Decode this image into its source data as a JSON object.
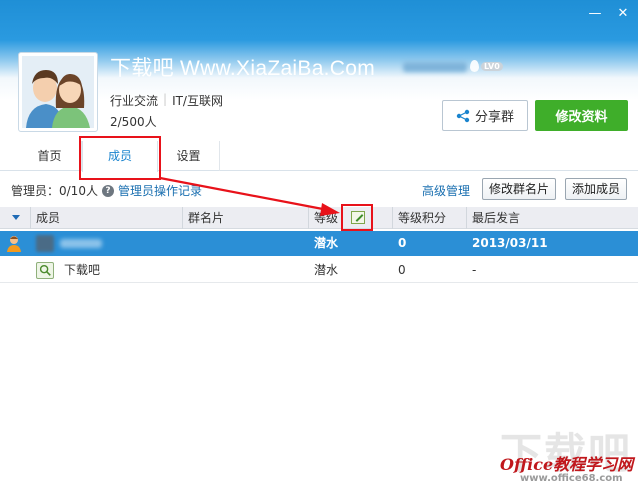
{
  "window": {
    "minimize_glyph": "—",
    "close_glyph": "✕"
  },
  "group": {
    "name": "下载吧 Www.XiaZaiBa.Com",
    "level_badge": "LV0",
    "category_1": "行业交流",
    "category_2": "IT/互联网",
    "members": "2/500人"
  },
  "buttons": {
    "share": "分享群",
    "edit_profile": "修改资料"
  },
  "tabs": [
    {
      "label": "首页"
    },
    {
      "label": "成员",
      "active": true
    },
    {
      "label": "设置"
    }
  ],
  "toolbar": {
    "admin_count": "管理员：0/10人",
    "admin_log": "管理员操作记录",
    "advanced": "高级管理",
    "edit_card": "修改群名片",
    "add_member": "添加成员"
  },
  "table": {
    "headers": [
      "成员",
      "群名片",
      "等级",
      "等级积分",
      "最后发言"
    ],
    "rows": [
      {
        "member": "",
        "card": "",
        "level": "潜水",
        "points": "0",
        "last_post": "2013/03/11",
        "selected": true
      },
      {
        "member": "下载吧",
        "card": "",
        "level": "潜水",
        "points": "0",
        "last_post": "-",
        "selected": false
      }
    ]
  },
  "watermark": {
    "big": "下载吧",
    "line1": "Office教程学习网",
    "line2": "www.office68.com"
  },
  "colors": {
    "header_blue": "#2a9ae0",
    "accent_green": "#3fae2a",
    "selected_row": "#2b8fd6",
    "annotation_red": "#e8121a"
  }
}
